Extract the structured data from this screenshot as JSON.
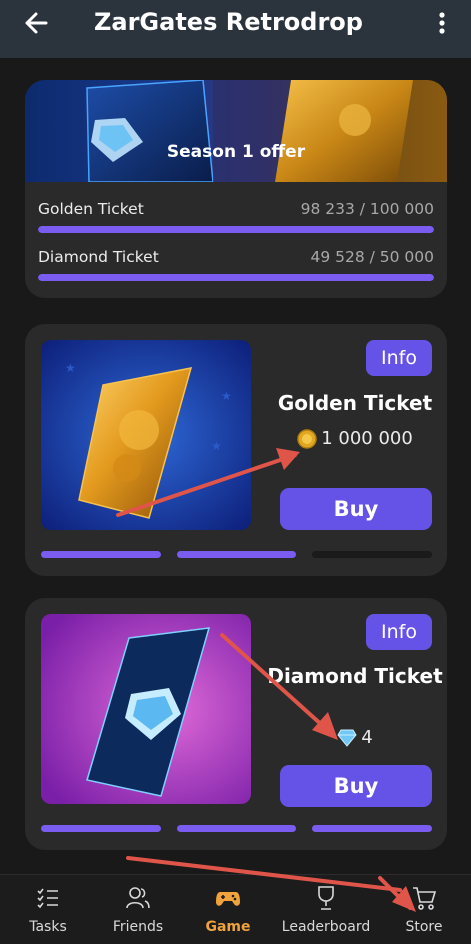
{
  "header": {
    "title": "ZarGates Retrodrop",
    "back_icon": "arrow-left-icon",
    "menu_icon": "more-vertical-icon"
  },
  "season": {
    "banner_title": "Season 1 offer",
    "progress": [
      {
        "label": "Golden Ticket",
        "count": "98 233 / 100 000",
        "fraction": 1.0
      },
      {
        "label": "Diamond Ticket",
        "count": "49 528 / 50 000",
        "fraction": 1.0
      }
    ]
  },
  "products": [
    {
      "name": "Golden Ticket",
      "info_label": "Info",
      "price": "1 000 000",
      "currency_icon": "coin-icon",
      "buy_label": "Buy",
      "pager": [
        true,
        true,
        false
      ]
    },
    {
      "name": "Diamond Ticket",
      "info_label": "Info",
      "price": "4",
      "currency_icon": "diamond-icon",
      "buy_label": "Buy",
      "pager": [
        true,
        true,
        true
      ]
    }
  ],
  "nav": {
    "items": [
      {
        "label": "Tasks",
        "icon": "tasks-icon",
        "active": false
      },
      {
        "label": "Friends",
        "icon": "friends-icon",
        "active": false
      },
      {
        "label": "Game",
        "icon": "gamepad-icon",
        "active": true
      },
      {
        "label": "Leaderboard",
        "icon": "leaderboard-icon",
        "active": false
      },
      {
        "label": "Store",
        "icon": "cart-icon",
        "active": false
      }
    ]
  },
  "colors": {
    "accent": "#6553e8",
    "progress": "#7b5cf0",
    "active_nav": "#f0a23c",
    "annotation_arrow": "#e0554a"
  }
}
